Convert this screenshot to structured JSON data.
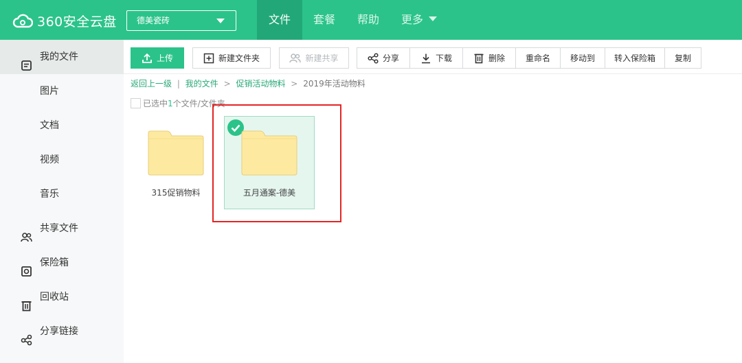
{
  "header": {
    "logo_text": "360安全云盘",
    "account_name": "德美瓷砖",
    "nav": [
      {
        "label": "文件"
      },
      {
        "label": "套餐"
      },
      {
        "label": "帮助"
      },
      {
        "label": "更多"
      }
    ]
  },
  "sidebar": {
    "items": [
      {
        "label": "我的文件",
        "icon": "my-files-icon"
      },
      {
        "label": "图片"
      },
      {
        "label": "文档"
      },
      {
        "label": "视频"
      },
      {
        "label": "音乐"
      },
      {
        "label": "共享文件",
        "icon": "shared-users-icon"
      },
      {
        "label": "保险箱",
        "icon": "safe-icon"
      },
      {
        "label": "回收站",
        "icon": "trash-icon"
      },
      {
        "label": "分享链接",
        "icon": "share-link-icon"
      }
    ]
  },
  "toolbar": {
    "upload": "上传",
    "new_folder": "新建文件夹",
    "new_share": "新建共享",
    "share": "分享",
    "download": "下载",
    "delete": "删除",
    "rename": "重命名",
    "move_to": "移动到",
    "to_safe": "转入保险箱",
    "copy": "复制"
  },
  "breadcrumb": {
    "back": "返回上一级",
    "divider": "|",
    "items": [
      "我的文件",
      "促销活动物料",
      "2019年活动物料"
    ],
    "separator": ">"
  },
  "selection": {
    "prefix": "已选中",
    "count": "1",
    "suffix": "个文件/文件夹"
  },
  "files": [
    {
      "name": "315促销物料",
      "selected": false
    },
    {
      "name": "五月通案-德美",
      "selected": true
    }
  ],
  "colors": {
    "brand": "#2bc38a",
    "highlight": "#e52424",
    "folder": "#fdeaa0"
  }
}
